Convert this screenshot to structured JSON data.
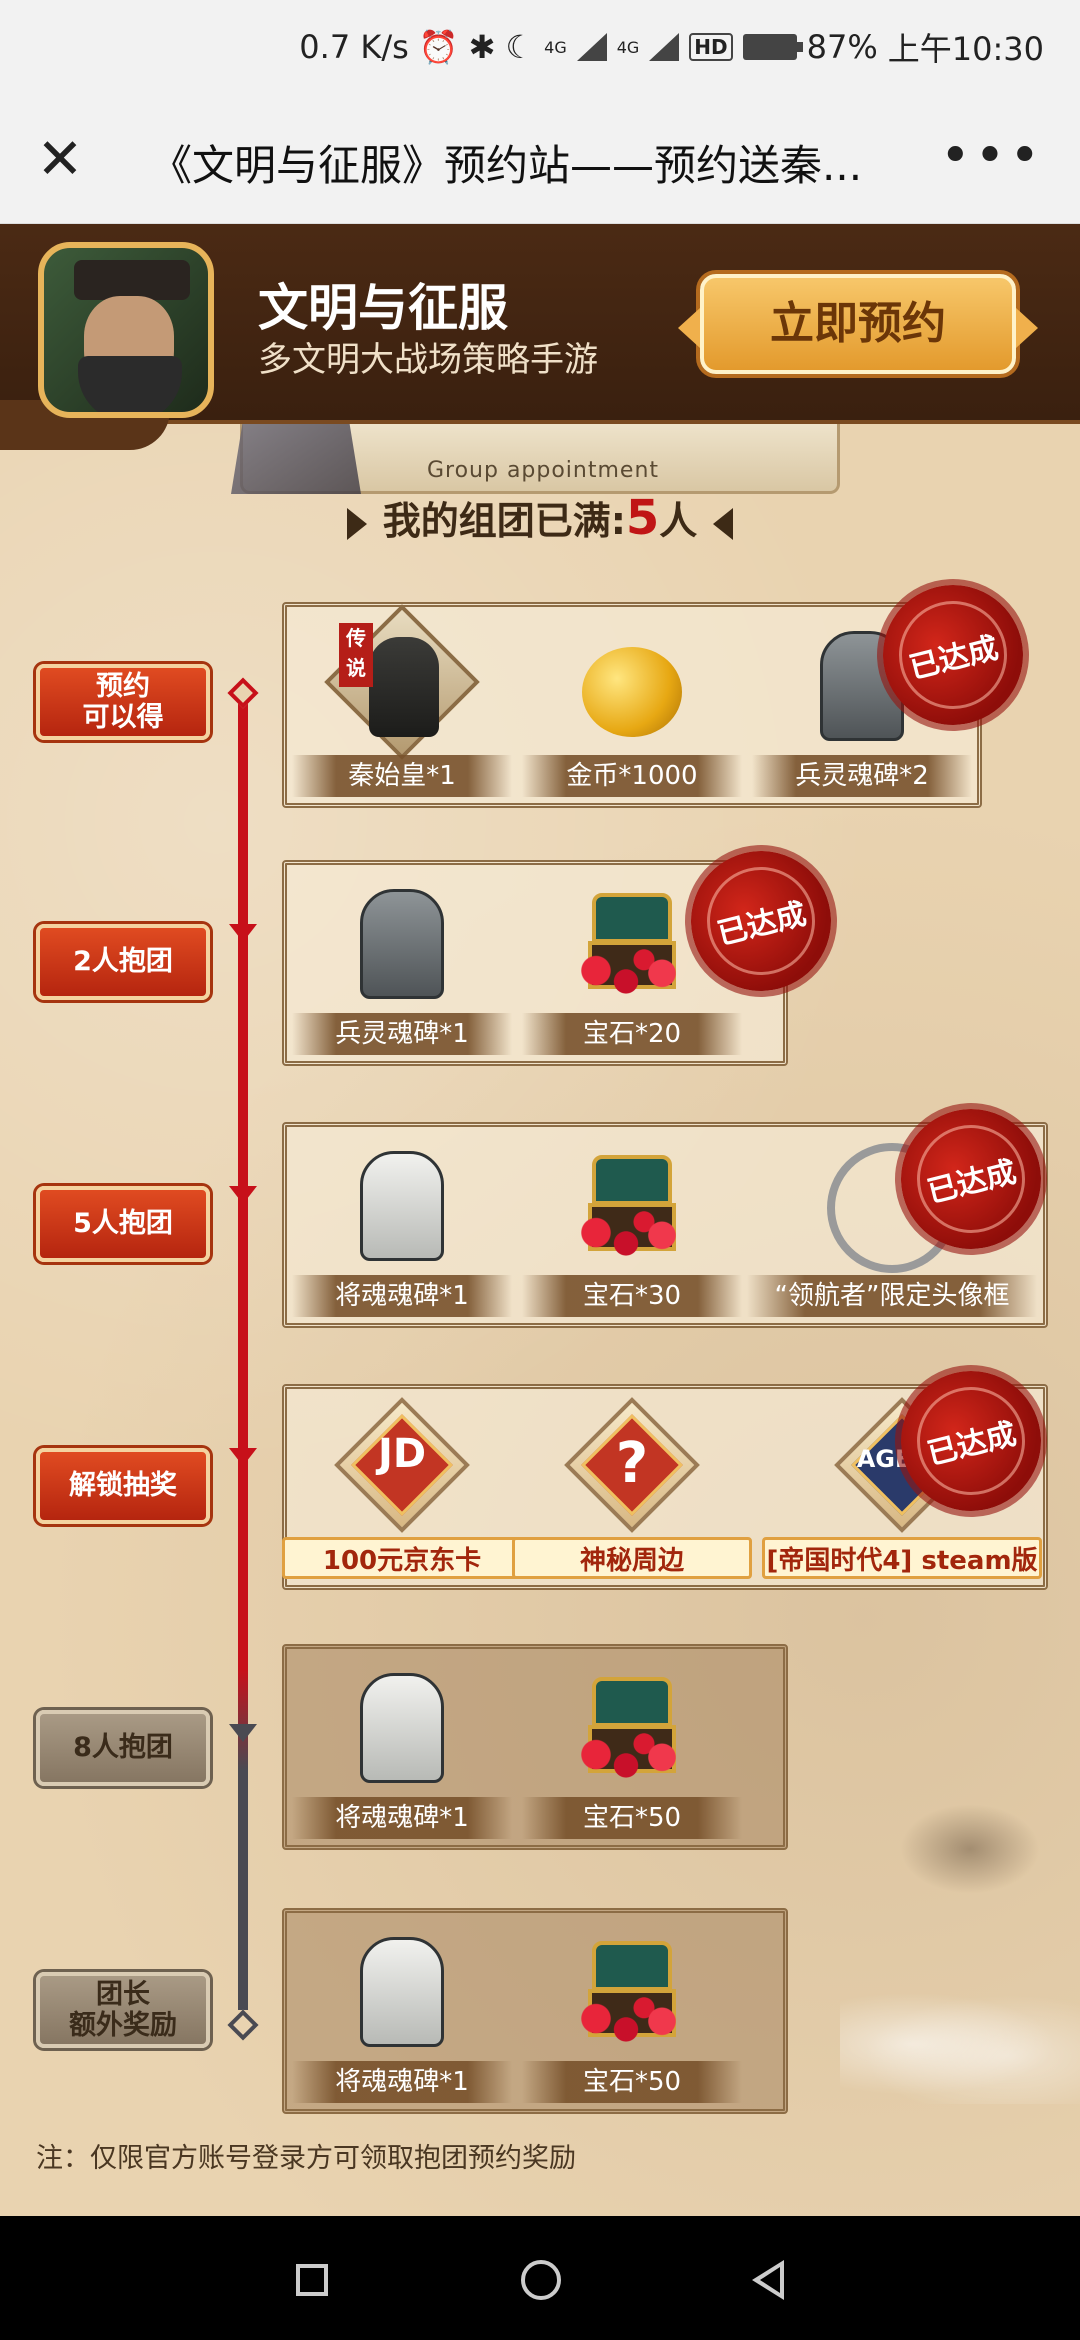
{
  "status_bar": {
    "speed": "0.7 K/s",
    "net1": "4G",
    "net2": "4G",
    "hd": "HD",
    "battery": "87%",
    "time": "上午10:30"
  },
  "title_bar": {
    "title": "《文明与征服》预约站——预约送秦..."
  },
  "banner": {
    "app_name": "文明与征服",
    "app_subtitle": "多文明大战场策略手游",
    "reserve_label": "立即预约"
  },
  "section": {
    "subtitle_en": "Group appointment",
    "team_prefix": "我的组团已满:",
    "team_count": "5",
    "team_suffix": "人"
  },
  "tiers": [
    {
      "label": "预约\n可以得",
      "active": true,
      "achieved": true,
      "seal": "已达成",
      "items": [
        {
          "label": "秦始皇*1",
          "icon": "hero-portrait",
          "tag": "传说"
        },
        {
          "label": "金币*1000",
          "icon": "gold-coin"
        },
        {
          "label": "兵灵魂碑*2",
          "icon": "dark-tablet"
        }
      ]
    },
    {
      "label": "2人抱团",
      "active": true,
      "achieved": true,
      "seal": "已达成",
      "items": [
        {
          "label": "兵灵魂碑*1",
          "icon": "dark-tablet"
        },
        {
          "label": "宝石*20",
          "icon": "gem-chest"
        }
      ]
    },
    {
      "label": "5人抱团",
      "active": true,
      "achieved": true,
      "seal": "已达成",
      "items": [
        {
          "label": "将魂魂碑*1",
          "icon": "silver-tablet"
        },
        {
          "label": "宝石*30",
          "icon": "gem-chest"
        },
        {
          "label": "“领航者”限定头像框",
          "icon": "avatar-frame"
        }
      ]
    },
    {
      "label": "解锁抽奖",
      "active": true,
      "achieved": true,
      "seal": "已达成",
      "items": [
        {
          "label": "100元京东卡",
          "icon": "jd-card",
          "symbol": "JD"
        },
        {
          "label": "神秘周边",
          "icon": "mystery-box",
          "symbol": "?"
        },
        {
          "label": "[帝国时代4] steam版",
          "icon": "game-cover",
          "symbol": "AGE IV"
        }
      ]
    },
    {
      "label": "8人抱团",
      "active": false,
      "achieved": false,
      "items": [
        {
          "label": "将魂魂碑*1",
          "icon": "silver-tablet"
        },
        {
          "label": "宝石*50",
          "icon": "gem-chest"
        }
      ]
    },
    {
      "label": "团长\n额外奖励",
      "active": false,
      "achieved": false,
      "items": [
        {
          "label": "将魂魂碑*1",
          "icon": "silver-tablet"
        },
        {
          "label": "宝石*50",
          "icon": "gem-chest"
        }
      ]
    }
  ],
  "note": "注：仅限官方账号登录方可领取抱团预约奖励",
  "colors": {
    "accent_red": "#c7101a",
    "label_orange": "#e04b21",
    "inactive_gray": "#4a4a52",
    "banner_brown": "#4b2a14"
  }
}
